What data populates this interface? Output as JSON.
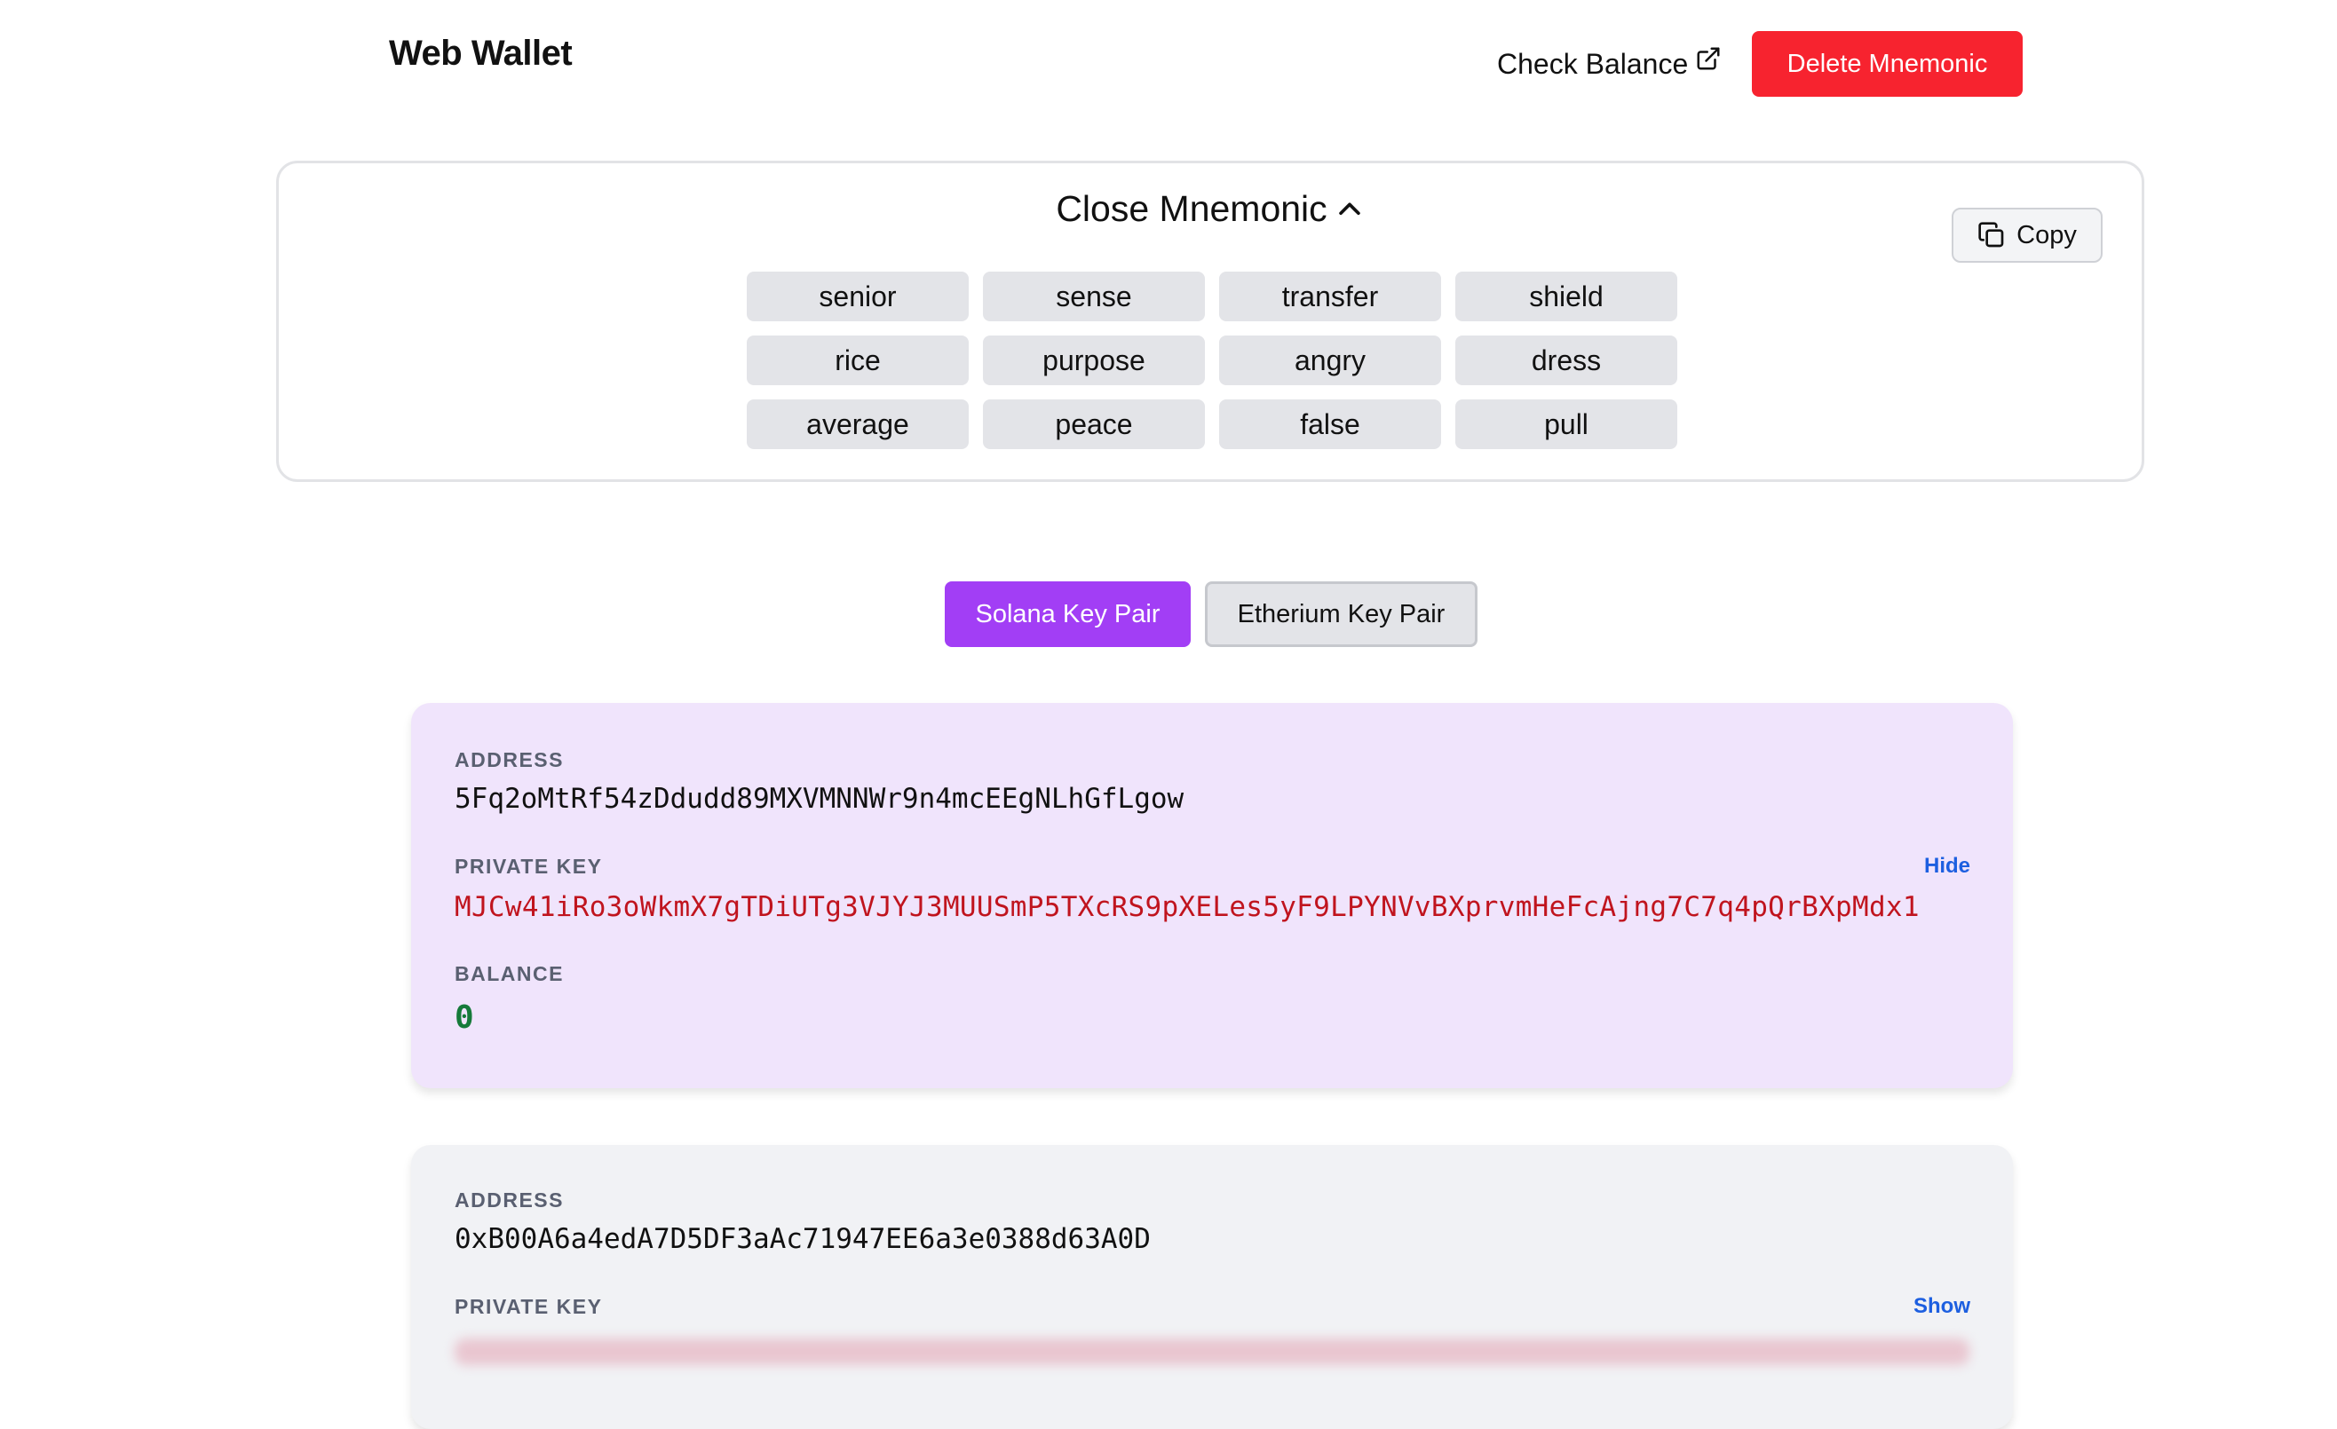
{
  "header": {
    "title": "Web Wallet",
    "check_balance": "Check Balance",
    "delete_button": "Delete Mnemonic"
  },
  "mnemonic": {
    "toggle_label": "Close Mnemonic",
    "copy_label": "Copy",
    "words": [
      "senior",
      "sense",
      "transfer",
      "shield",
      "rice",
      "purpose",
      "angry",
      "dress",
      "average",
      "peace",
      "false",
      "pull"
    ]
  },
  "tabs": {
    "solana": "Solana Key Pair",
    "ethereum": "Etherium Key Pair",
    "active": "solana"
  },
  "solana_card": {
    "address_label": "ADDRESS",
    "address": "5Fq2oMtRf54zDdudd89MXVMNNWr9n4mcEEgNLhGfLgow",
    "private_key_label": "PRIVATE KEY",
    "private_key_toggle": "Hide",
    "private_key": "MJCw41iRo3oWkmX7gTDiUTg3VJYJ3MUUSmP5TXcRS9pXELes5yF9LPYNVvBXprvmHeFcAjng7C7q4pQrBXpMdx1",
    "balance_label": "BALANCE",
    "balance": "0"
  },
  "ethereum_card": {
    "address_label": "ADDRESS",
    "address": "0xB00A6a4edA7D5DF3aAc71947EE6a3e0388d63A0D",
    "private_key_label": "PRIVATE KEY",
    "private_key_toggle": "Show"
  },
  "colors": {
    "delete": "#f7232f",
    "solana_accent": "#a23ef5",
    "solana_card_bg": "#f0e4fc",
    "eth_card_bg": "#f1f2f5",
    "link": "#1d5fe0",
    "private_key_text": "#c0141e",
    "balance_text": "#167a3a"
  }
}
